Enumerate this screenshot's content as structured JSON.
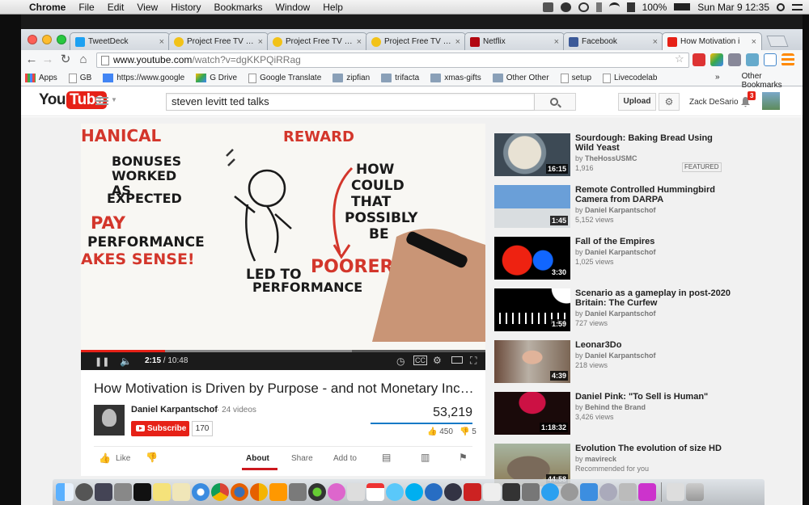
{
  "menubar": {
    "app": "Chrome",
    "items": [
      "File",
      "Edit",
      "View",
      "History",
      "Bookmarks",
      "Window",
      "Help"
    ],
    "battery": "100%",
    "clock": "Sun Mar 9  12:35"
  },
  "browser": {
    "tabs": [
      {
        "title": "TweetDeck",
        "color": "#1da1f2"
      },
      {
        "title": "Project Free TV :: Fe",
        "color": "#f2c218"
      },
      {
        "title": "Project Free TV – Wa",
        "color": "#f2c218"
      },
      {
        "title": "Project Free TV – Wa",
        "color": "#f2c218"
      },
      {
        "title": "Netflix",
        "color": "#b20710"
      },
      {
        "title": "Facebook",
        "color": "#3b5998"
      },
      {
        "title": "How Motivation i",
        "color": "#e62117"
      }
    ],
    "url_host": "www.youtube.com",
    "url_rest": "/watch?v=dgKKPQiRRag",
    "bookmarks": [
      "Apps",
      "GB",
      "https://www.google",
      "G Drive",
      "Google Translate",
      "zipfian",
      "trifacta",
      "xmas-gifts",
      "Other Other",
      "setup",
      "Livecodelab"
    ],
    "bookmarks_more": "»",
    "other_bookmarks": "Other Bookmarks"
  },
  "youtube": {
    "logo_you": "You",
    "logo_tube": "Tube",
    "search_query": "steven levitt ted talks",
    "upload_label": "Upload",
    "user_name": "Zack DeSario",
    "notification_count": "3"
  },
  "video": {
    "current_time": "2:15",
    "duration": "/ 10:48",
    "progress_fraction": 0.208,
    "loaded_fraction": 0.67,
    "drawing_text": [
      "HANICAL",
      "REWARD",
      "BONUSES",
      "WORKED",
      "AS",
      "EXPECTED",
      "PAY",
      "PERFORMANCE",
      "AKES SENSE!",
      "HOW",
      "COULD",
      "THAT",
      "POSSIBLY",
      "BE",
      "LED TO",
      "POORER",
      "PERFORMANCE"
    ],
    "title": "How Motivation is Driven by Purpose - and not Monetary Incenti…",
    "owner": "Daniel Karpantschof",
    "owner_videos": "· 24 videos",
    "subscribe_label": "Subscribe",
    "subscriber_count": "170",
    "views": "53,219",
    "likes": "450",
    "dislikes": "5",
    "actions": {
      "like": "Like",
      "about": "About",
      "share": "Share",
      "add_to": "Add to"
    }
  },
  "recommendations": [
    {
      "title": "Sourdough: Baking Bread Using Wild Yeast",
      "channel": "TheHossUSMC",
      "views": "1,916",
      "duration": "16:15",
      "badge": "FEATURED"
    },
    {
      "title": "Remote Controlled Hummingbird Camera from DARPA",
      "channel": "Daniel Karpantschof",
      "views": "5,152 views",
      "duration": "1:45"
    },
    {
      "title": "Fall of the Empires",
      "channel": "Daniel Karpantschof",
      "views": "1,025 views",
      "duration": "3:30"
    },
    {
      "title": "Scenario as a gameplay in post-2020 Britain: The Curfew",
      "channel": "Daniel Karpantschof",
      "views": "727 views",
      "duration": "1:59"
    },
    {
      "title": "Leonar3Do",
      "channel": "Daniel Karpantschof",
      "views": "218 views",
      "duration": "4:39"
    },
    {
      "title": "Daniel Pink: \"To Sell is Human\"",
      "channel": "Behind the Brand",
      "views": "3,426 views",
      "duration": "1:18:32"
    },
    {
      "title": "Evolution The evolution of size HD",
      "channel": "mavireck",
      "views": "Recommended for you",
      "duration": "44:58"
    }
  ],
  "by_prefix": "by"
}
